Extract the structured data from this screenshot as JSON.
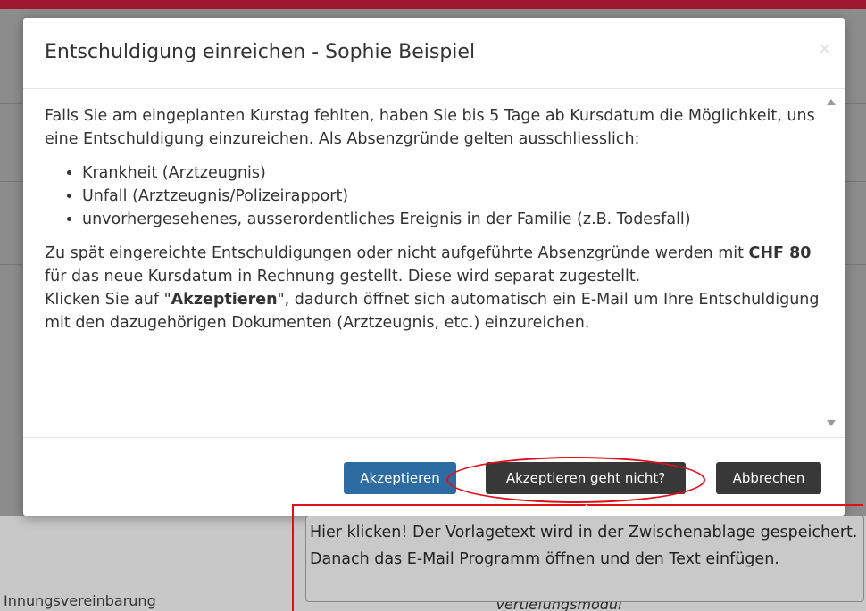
{
  "modal": {
    "title": "Entschuldigung einreichen - Sophie Beispiel",
    "close_label": "×",
    "intro": "Falls Sie am eingeplanten Kurstag fehlten, haben Sie bis 5 Tage ab Kursdatum die Möglichkeit, uns eine Entschuldigung einzureichen. Als Absenzgründe gelten ausschliesslich:",
    "reasons": [
      "Krankheit (Arztzeugnis)",
      "Unfall (Arztzeugnis/Polizeirapport)",
      "unvorhergesehenes, ausserordentliches Ereignis in der Familie (z.B. Todesfall)"
    ],
    "late_part1": "Zu spät eingereichte Entschuldigungen oder nicht aufgeführte Absenzgründe werden mit ",
    "late_fee": "CHF 80",
    "late_part2": " für das neue Kursdatum in Rechnung gestellt. Diese wird separat zugestellt.",
    "click_part1": "Klicken Sie auf \"",
    "click_button_ref": "Akzeptieren",
    "click_part2": "\", dadurch öffnet sich automatisch ein E-Mail um Ihre Entschuldigung mit den dazugehörigen Dokumenten (Arztzeugnis, etc.) einzureichen."
  },
  "footer": {
    "accept_label": "Akzeptieren",
    "accept_fails_label": "Akzeptieren geht nicht?",
    "cancel_label": "Abbrechen"
  },
  "tooltip": {
    "text": "Hier klicken! Der Vorlagetext wird in der Zwischenablage gespeichert. Danach das E-Mail Programm öffnen und den Text einfügen."
  },
  "background": {
    "partial_text_left": "Innungsvereinbarung",
    "partial_text_right": "Vertiefungsmodul"
  },
  "colors": {
    "topbar": "#9b1830",
    "accept_button": "#2d6ca2",
    "dark_button": "#383838",
    "annotation_red": "#e0101a"
  }
}
